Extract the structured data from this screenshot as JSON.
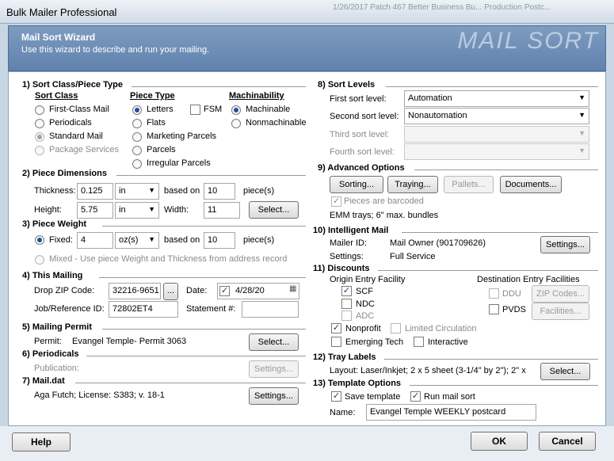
{
  "window": {
    "title": "Bulk Mailer Professional",
    "background_ghost": [
      "1/26/2017  Patch 467   Better Business Bu...   Production Postc..."
    ]
  },
  "header": {
    "title": "Mail Sort Wizard",
    "subtitle": "Use this wizard to describe and run your mailing.",
    "watermark": "MAIL SORT"
  },
  "sort_class_section": {
    "heading": "1) Sort Class/Piece Type",
    "sort_class_label": "Sort Class",
    "piece_type_label": "Piece Type",
    "machinability_label": "Machinability",
    "sort_class_options": [
      "First-Class Mail",
      "Periodicals",
      "Standard Mail",
      "Package Services"
    ],
    "piece_type_options": [
      "Letters",
      "Flats",
      "Marketing Parcels",
      "Parcels",
      "Irregular Parcels"
    ],
    "fsm_label": "FSM",
    "machinability_options": [
      "Machinable",
      "Nonmachinable"
    ]
  },
  "piece_dimensions": {
    "heading": "2) Piece Dimensions",
    "thickness_label": "Thickness:",
    "thickness_value": "0.125",
    "thickness_unit": "in",
    "based_on_label": "based on",
    "based_on_value": "10",
    "pieces_label": "piece(s)",
    "height_label": "Height:",
    "height_value": "5.75",
    "height_unit": "in",
    "width_label": "Width:",
    "width_value": "11",
    "select_button": "Select..."
  },
  "piece_weight": {
    "heading": "3) Piece Weight",
    "fixed_label": "Fixed:",
    "fixed_value": "4",
    "fixed_unit": "oz(s)",
    "based_on_label": "based on",
    "based_on_value": "10",
    "pieces_label": "piece(s)",
    "mixed_label": "Mixed - Use piece Weight and Thickness from address record"
  },
  "this_mailing": {
    "heading": "4) This Mailing",
    "drop_zip_label": "Drop ZIP Code:",
    "drop_zip_value": "32216-9651",
    "browse_button": "...",
    "date_label": "Date:",
    "date_value": "4/28/20",
    "job_ref_label": "Job/Reference ID:",
    "job_ref_value": "72802ET4",
    "statement_label": "Statement #:",
    "statement_value": ""
  },
  "mailing_permit": {
    "heading": "5) Mailing Permit",
    "permit_label": "Permit:",
    "permit_value": "Evangel Temple- Permit 3063",
    "select_button": "Select..."
  },
  "periodicals": {
    "heading": "6) Periodicals",
    "publication_label": "Publication:",
    "settings_button": "Settings..."
  },
  "maildat": {
    "heading": "7) Mail.dat",
    "value": "Aga Futch; License: S383; v. 18-1",
    "settings_button": "Settings..."
  },
  "sort_levels": {
    "heading": "8) Sort Levels",
    "first_label": "First sort level:",
    "first_value": "Automation",
    "second_label": "Second sort level:",
    "second_value": "Nonautomation",
    "third_label": "Third sort level:",
    "third_value": "",
    "fourth_label": "Fourth sort level:",
    "fourth_value": ""
  },
  "advanced_options": {
    "heading": "9) Advanced Options",
    "buttons": [
      "Sorting...",
      "Traying...",
      "Pallets...",
      "Documents..."
    ],
    "barcoded_label": "Pieces are barcoded",
    "emm_text": "EMM trays; 6\" max. bundles"
  },
  "intelligent_mail": {
    "heading": "10) Intelligent Mail",
    "mailer_id_label": "Mailer ID:",
    "mailer_id_value": "Mail Owner (901709626)",
    "settings_label": "Settings:",
    "settings_value": "Full Service",
    "settings_button": "Settings..."
  },
  "discounts": {
    "heading": "11) Discounts",
    "origin_label": "Origin Entry Facility",
    "origin_options": [
      "SCF",
      "NDC",
      "ADC"
    ],
    "destination_label": "Destination Entry Facilities",
    "ddu_label": "DDU",
    "pvds_label": "PVDS",
    "zip_codes_button": "ZIP Codes...",
    "facilities_button": "Facilities...",
    "nonprofit_label": "Nonprofit",
    "limited_circulation_label": "Limited Circulation",
    "emerging_tech_label": "Emerging Tech",
    "interactive_label": "Interactive"
  },
  "tray_labels": {
    "heading": "12) Tray Labels",
    "layout_text": "Layout: Laser/Inkjet; 2 x 5 sheet (3-1/4\" by 2\"); 2\" x",
    "select_button": "Select..."
  },
  "template_options": {
    "heading": "13) Template Options",
    "save_template_label": "Save template",
    "run_mail_sort_label": "Run mail sort",
    "name_label": "Name:",
    "name_value": "Evangel Temple WEEKLY postcard"
  },
  "footer": {
    "help_button": "Help",
    "ok_button": "OK",
    "cancel_button": "Cancel"
  },
  "colors": {
    "header_blue": "#6e8fb8",
    "radio_selected": "#1e4fa3",
    "window_frame": "#c9d6e4"
  }
}
